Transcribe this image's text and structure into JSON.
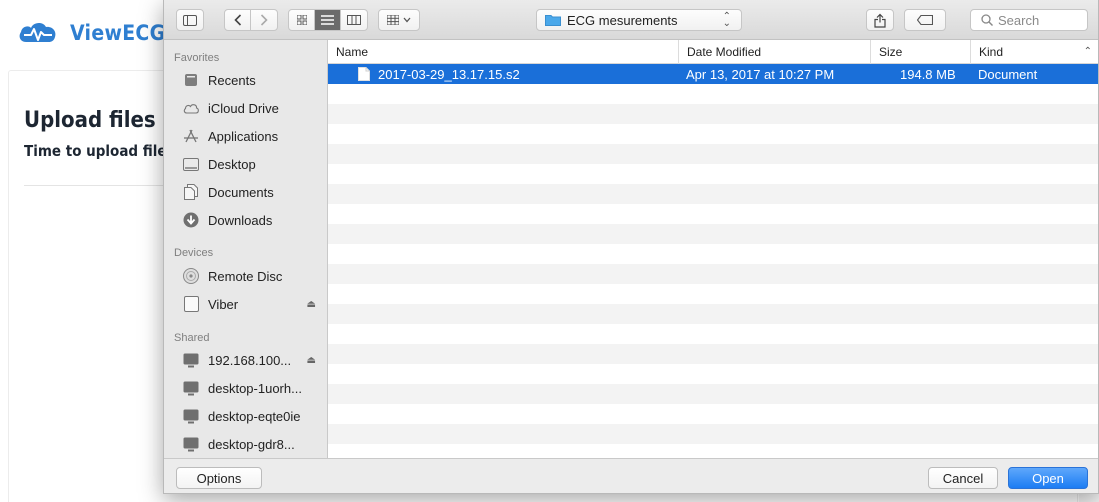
{
  "background_page": {
    "logo_text": "ViewECG",
    "card_title": "Upload files",
    "card_subtitle": "Time to upload files"
  },
  "dialog": {
    "toolbar": {
      "path_folder": "ECG mesurements",
      "search_placeholder": "Search"
    },
    "sidebar": {
      "sections": [
        {
          "title": "Favorites",
          "items": [
            {
              "label": "Recents",
              "icon": "recents-icon"
            },
            {
              "label": "iCloud Drive",
              "icon": "cloud-icon"
            },
            {
              "label": "Applications",
              "icon": "applications-icon"
            },
            {
              "label": "Desktop",
              "icon": "desktop-icon"
            },
            {
              "label": "Documents",
              "icon": "documents-icon"
            },
            {
              "label": "Downloads",
              "icon": "downloads-icon"
            }
          ]
        },
        {
          "title": "Devices",
          "items": [
            {
              "label": "Remote Disc",
              "icon": "disc-icon"
            },
            {
              "label": "Viber",
              "icon": "drive-icon",
              "eject": true
            }
          ]
        },
        {
          "title": "Shared",
          "items": [
            {
              "label": "192.168.100...",
              "icon": "computer-icon",
              "eject": true
            },
            {
              "label": "desktop-1uorh...",
              "icon": "computer-icon"
            },
            {
              "label": "desktop-eqte0ie",
              "icon": "computer-icon"
            },
            {
              "label": "desktop-gdr8...",
              "icon": "computer-icon"
            }
          ]
        }
      ]
    },
    "columns": {
      "name": "Name",
      "date_modified": "Date Modified",
      "size": "Size",
      "kind": "Kind"
    },
    "files": [
      {
        "name": "2017-03-29_13.17.15.s2",
        "date_modified": "Apr 13, 2017 at 10:27 PM",
        "size": "194.8 MB",
        "kind": "Document",
        "selected": true
      }
    ],
    "footer": {
      "options_label": "Options",
      "cancel_label": "Cancel",
      "open_label": "Open"
    }
  }
}
